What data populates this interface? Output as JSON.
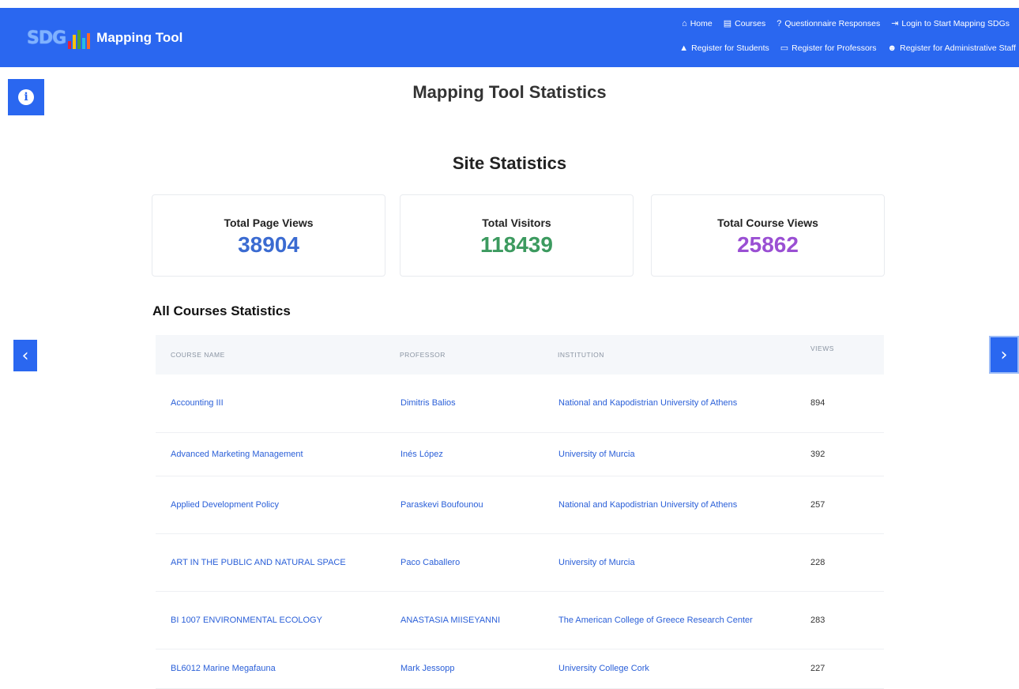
{
  "navbar": {
    "logo_text": "SDG",
    "logo_bar_colors": [
      "#e5243b",
      "#fcc30b",
      "#4c9f38",
      "#26bde2",
      "#fd6925"
    ],
    "brand_title": "Mapping Tool",
    "row1": [
      {
        "icon": "home-icon",
        "glyph": "⌂",
        "label": "Home"
      },
      {
        "icon": "book-icon",
        "glyph": "▤",
        "label": "Courses"
      },
      {
        "icon": "question-circle-icon",
        "glyph": "?",
        "label": "Questionnaire Responses"
      },
      {
        "icon": "login-icon",
        "glyph": "⇥",
        "label": "Login to Start Mapping SDGs"
      }
    ],
    "row2": [
      {
        "icon": "graduation-cap-icon",
        "glyph": "▲",
        "label": "Register for Students"
      },
      {
        "icon": "chalkboard-icon",
        "glyph": "▭",
        "label": "Register for Professors"
      },
      {
        "icon": "users-icon",
        "glyph": "☻",
        "label": "Register for Administrative Staff"
      }
    ],
    "accent_color": "#2a67f0"
  },
  "side": {
    "info_icon": "info-icon",
    "info_glyph": "i",
    "left_arrow_icon": "chevron-left-icon",
    "left_glyph": "‹",
    "right_arrow_icon": "chevron-right-icon",
    "right_glyph": "›"
  },
  "page": {
    "title": "Mapping Tool Statistics",
    "section_title": "Site Statistics",
    "courses_heading": "All Courses Statistics"
  },
  "stats": [
    {
      "label": "Total Page Views",
      "value": "38904",
      "color": "#3b6bd1"
    },
    {
      "label": "Total Visitors",
      "value": "118439",
      "color": "#3c9a5f"
    },
    {
      "label": "Total Course Views",
      "value": "25862",
      "color": "#9a4fd3"
    }
  ],
  "table": {
    "headers": {
      "course": "COURSE NAME",
      "professor": "PROFESSOR",
      "institution": "INSTITUTION",
      "views": "VIEWS"
    },
    "rows": [
      {
        "course": "Accounting III",
        "professor": "Dimitris Balios",
        "institution": "National and Kapodistrian University of Athens",
        "views": "894"
      },
      {
        "course": "Advanced Marketing Management",
        "professor": "Inés López",
        "institution": "University of Murcia",
        "views": "392"
      },
      {
        "course": "Applied Development Policy",
        "professor": "Paraskevi Boufounou",
        "institution": "National and Kapodistrian University of Athens",
        "views": "257"
      },
      {
        "course": "ART IN THE PUBLIC AND NATURAL SPACE",
        "professor": "Paco Caballero",
        "institution": "University of Murcia",
        "views": "228"
      },
      {
        "course": "BI 1007 ENVIRONMENTAL ECOLOGY",
        "professor": "ANASTASIA MIISEYANNI",
        "institution": "The American College of Greece Research Center",
        "views": "283"
      },
      {
        "course": "BL6012 Marine Megafauna",
        "professor": "Mark Jessopp",
        "institution": "University College Cork",
        "views": "227"
      }
    ]
  }
}
